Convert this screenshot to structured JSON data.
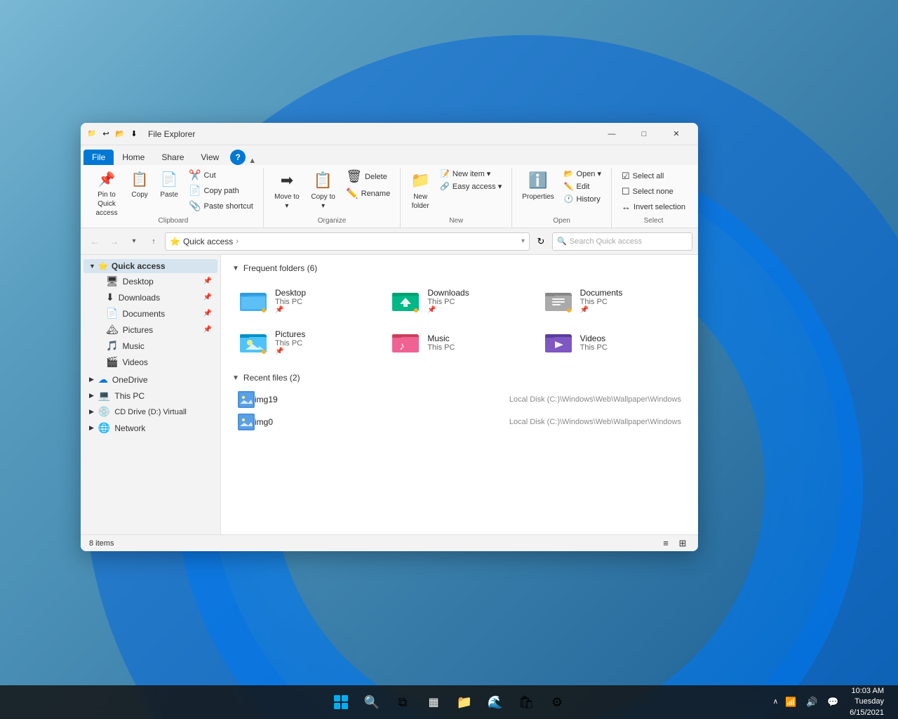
{
  "window": {
    "title": "File Explorer",
    "titlebar_icons": [
      "📁",
      "↩",
      "📂",
      "⬇"
    ],
    "controls": {
      "minimize": "—",
      "maximize": "□",
      "close": "✕"
    }
  },
  "ribbon": {
    "tabs": [
      {
        "label": "File",
        "active": true
      },
      {
        "label": "Home",
        "active": false
      },
      {
        "label": "Share",
        "active": false
      },
      {
        "label": "View",
        "active": false
      }
    ],
    "groups": {
      "clipboard": {
        "label": "Clipboard",
        "items": [
          {
            "icon": "📌",
            "label": "Pin to Quick\naccess",
            "id": "pin-quick-access"
          },
          {
            "icon": "📋",
            "label": "Copy",
            "id": "copy"
          },
          {
            "icon": "📄",
            "label": "Paste",
            "id": "paste"
          }
        ],
        "small_items": [
          {
            "icon": "✂️",
            "label": "Cut"
          },
          {
            "icon": "📄",
            "label": "Copy path"
          },
          {
            "icon": "📎",
            "label": "Paste shortcut"
          }
        ]
      },
      "organize": {
        "label": "Organize",
        "items": [
          {
            "icon": "➡",
            "label": "Move to ▾"
          },
          {
            "icon": "📋",
            "label": "Copy to ▾"
          }
        ],
        "delete_rename": [
          {
            "icon": "🗑",
            "label": "Delete"
          },
          {
            "icon": "✏️",
            "label": "Rename"
          }
        ]
      },
      "new": {
        "label": "New",
        "items": [
          {
            "icon": "📁",
            "label": "New\nfolder"
          },
          {
            "icon": "📝",
            "label": "New item ▾"
          },
          {
            "icon": "🔗",
            "label": "Easy access ▾"
          }
        ]
      },
      "open": {
        "label": "Open",
        "items": [
          {
            "icon": "👁",
            "label": "Properties"
          },
          {
            "icon": "📂",
            "label": "Open ▾"
          },
          {
            "icon": "✏️",
            "label": "Edit"
          },
          {
            "icon": "🕐",
            "label": "History"
          }
        ]
      },
      "select": {
        "label": "Select",
        "items": [
          {
            "icon": "☑",
            "label": "Select all"
          },
          {
            "icon": "☐",
            "label": "Select none"
          },
          {
            "icon": "↔",
            "label": "Invert selection"
          }
        ]
      }
    }
  },
  "address_bar": {
    "path_icon": "⭐",
    "path": "Quick access",
    "chevron": ">",
    "search_placeholder": "Search Quick access"
  },
  "sidebar": {
    "quick_access": {
      "label": "Quick access",
      "expanded": true,
      "children": [
        {
          "icon": "🖥",
          "label": "Desktop",
          "pinned": true
        },
        {
          "icon": "⬇",
          "label": "Downloads",
          "pinned": true
        },
        {
          "icon": "📄",
          "label": "Documents",
          "pinned": true
        },
        {
          "icon": "🏔",
          "label": "Pictures",
          "pinned": true
        },
        {
          "icon": "🎵",
          "label": "Music"
        },
        {
          "icon": "🎬",
          "label": "Videos"
        }
      ]
    },
    "onedrive": {
      "label": "OneDrive",
      "icon": "☁"
    },
    "this_pc": {
      "label": "This PC",
      "icon": "💻"
    },
    "cd_drive": {
      "label": "CD Drive (D:) Virtuall",
      "icon": "💿"
    },
    "network": {
      "label": "Network",
      "icon": "🌐"
    }
  },
  "content": {
    "frequent_folders_header": "Frequent folders (6)",
    "frequent_folders": [
      {
        "name": "Desktop",
        "path": "This PC",
        "color": "#2e9de0",
        "type": "desktop"
      },
      {
        "name": "Downloads",
        "path": "This PC",
        "color": "#00b386",
        "type": "downloads"
      },
      {
        "name": "Documents",
        "path": "This PC",
        "color": "#888",
        "type": "documents"
      },
      {
        "name": "Pictures",
        "path": "This PC",
        "color": "#4fc3f7",
        "type": "pictures"
      },
      {
        "name": "Music",
        "path": "This PC",
        "color": "#f06292",
        "type": "music"
      },
      {
        "name": "Videos",
        "path": "This PC",
        "color": "#7e57c2",
        "type": "videos"
      }
    ],
    "recent_files_header": "Recent files (2)",
    "recent_files": [
      {
        "name": "img19",
        "path": "Local Disk (C:)\\Windows\\Web\\Wallpaper\\Windows"
      },
      {
        "name": "img0",
        "path": "Local Disk (C:)\\Windows\\Web\\Wallpaper\\Windows"
      }
    ]
  },
  "status_bar": {
    "count": "8 items"
  },
  "taskbar": {
    "time": "10:03 AM",
    "date": "Tuesday\n6/15/2021",
    "icons": [
      {
        "name": "start",
        "symbol": "⊞"
      },
      {
        "name": "search",
        "symbol": "🔍"
      },
      {
        "name": "task-view",
        "symbol": "⧉"
      },
      {
        "name": "widgets",
        "symbol": "▦"
      },
      {
        "name": "file-explorer",
        "symbol": "📁"
      },
      {
        "name": "edge",
        "symbol": "🌊"
      },
      {
        "name": "store",
        "symbol": "🛍"
      },
      {
        "name": "settings",
        "symbol": "⚙"
      }
    ]
  }
}
